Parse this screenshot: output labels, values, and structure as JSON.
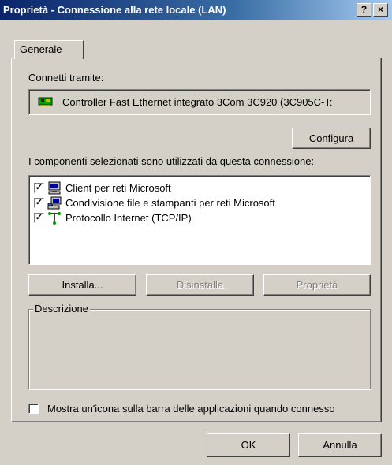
{
  "window": {
    "title": "Proprietà - Connessione alla rete locale (LAN)",
    "help_glyph": "?",
    "close_glyph": "×"
  },
  "tabs": [
    {
      "label": "Generale"
    }
  ],
  "connect_using": {
    "label": "Connetti tramite:",
    "adapter_name": "Controller Fast Ethernet integrato 3Com 3C920 (3C905C-T:",
    "adapter_icon": "network-card-icon",
    "configure_label": "Configura"
  },
  "components": {
    "label": "I componenti selezionati sono utilizzati da questa connessione:",
    "items": [
      {
        "label": "Client per reti Microsoft",
        "checked": true,
        "icon": "network-client-icon"
      },
      {
        "label": "Condivisione file e stampanti per reti Microsoft",
        "checked": true,
        "icon": "file-printer-sharing-icon"
      },
      {
        "label": "Protocollo Internet (TCP/IP)",
        "checked": true,
        "icon": "protocol-icon"
      }
    ]
  },
  "buttons": {
    "install": "Installa...",
    "uninstall": "Disinstalla",
    "properties": "Proprietà"
  },
  "description": {
    "title": "Descrizione",
    "text": ""
  },
  "show_icon": {
    "label": "Mostra un'icona sulla barra delle applicazioni quando connesso",
    "checked": false
  },
  "footer": {
    "ok": "OK",
    "cancel": "Annulla"
  },
  "colors": {
    "titlebar_start": "#0a246a",
    "titlebar_end": "#a6caf0",
    "face": "#d4d0c8"
  }
}
